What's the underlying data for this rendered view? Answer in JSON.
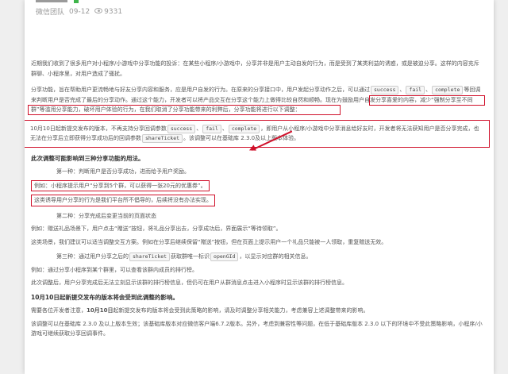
{
  "meta": {
    "author": "微信团队",
    "date": "09-12",
    "views": "9331"
  },
  "p1": "近期我们收到了很多用户对小程序/小游戏中分享功能的投诉：在某些小程序/小游戏中，分享并非是用户主动自发的行为，而是受到了某类利益的诱惑，或是被迫分享。这样的内容充斥群聊、小程序里，对用户造成了骚扰。",
  "p2": {
    "a": "分享功能，旨在帮助用户更流畅地与好友分享内容和服务，应是用户自发的行为。在原来的分享接口中，用户发起分享动作之后，可以通过",
    "k1": "success",
    "k2": "fail",
    "k3": "complete",
    "b": "等回调来判断用户是否完成了最后的分享动作。通过这个能力，开发者可以将产品交互在分享这个能力上做得比较自然和顺畅。",
    "hl": "现在为鼓励用户自发分享喜爱的内容，减少“强制分享至不同群”等滥用分享能力，破坏用户体验的行为，",
    "c": "在我们取消了分享功能带来的利弊后，分享功能将进行以下调整："
  },
  "box": {
    "a": "10月10日起新提交发布的版本，不再支持分享回调参数",
    "k1": "success",
    "k2": "fail",
    "k3": "complete",
    "b": "，即用户从小程序/小游戏中分享消息给好友时，开发者将无法获知用户是否分享完成，也无法在分享后立即获得分享成功后的回调参数",
    "k4": "shareTicket",
    "c": "。该调整可以在基础库 2.3.0及以上版本体验。"
  },
  "h1": "此次调整可能影响到三种分享功能的用法。",
  "first": "第一种：判断用户是否分享成功，进而给予用户奖励。",
  "ex1": "例如：小程序提示用户“分享到5个群，可以获得一张20元的优惠券”。",
  "ex2": "这类诱导用户分享的行为是我们平台所不倡导的，后续将没有办法实现。",
  "second": "第二种：分享完成后变更当前的页面状态",
  "ex3": "例如：赠送礼品场景下，用户点击“赠送”按钮，将礼品分享出去，分享成功后，界面展示“等待领取”。",
  "ex4": "这类场景，我们建议可以适当调整交互方案。例如在分享后继续保留“赠送”按钮，但在页面上提示用户一个礼品只能被一人领取，重复赠送无效。",
  "third": {
    "a": "第三种：通过用户分享之后的",
    "k1": "shareTicket",
    "b": "获取群唯一标识",
    "k2": "openGId",
    "c": "，以显示对应群的相关信息。"
  },
  "ex5": "例如：通过分享小程序到某个群里，可以查看该群内成员的排行榜。",
  "ex6": "此次调整后，用户分享完成后无法立刻显示该群的排行榜信息，但仍可在用户从群消息点击进入小程序时显示该群的排行榜信息。",
  "h2": "10月10日起新提交发布的版本将会受到此调整的影响。",
  "p3": {
    "a": "需要各位开发者注意，",
    "b": "10月10日",
    "c": "起新提交发布的版本将会受到此策略的影响，请及时调整分享相关能力，考虑兼容上述调整带来的影响。"
  },
  "p4": "该调整可以在基础库 2.3.0 及以上版本生效；该基础库版本对应微信客户端6.7.2版本。另外，考虑到兼容性等问题，在低于基础库版本 2.3.0 以下的环境中不受此策略影响，小程序/小游戏可继续获取分享回调事件。"
}
